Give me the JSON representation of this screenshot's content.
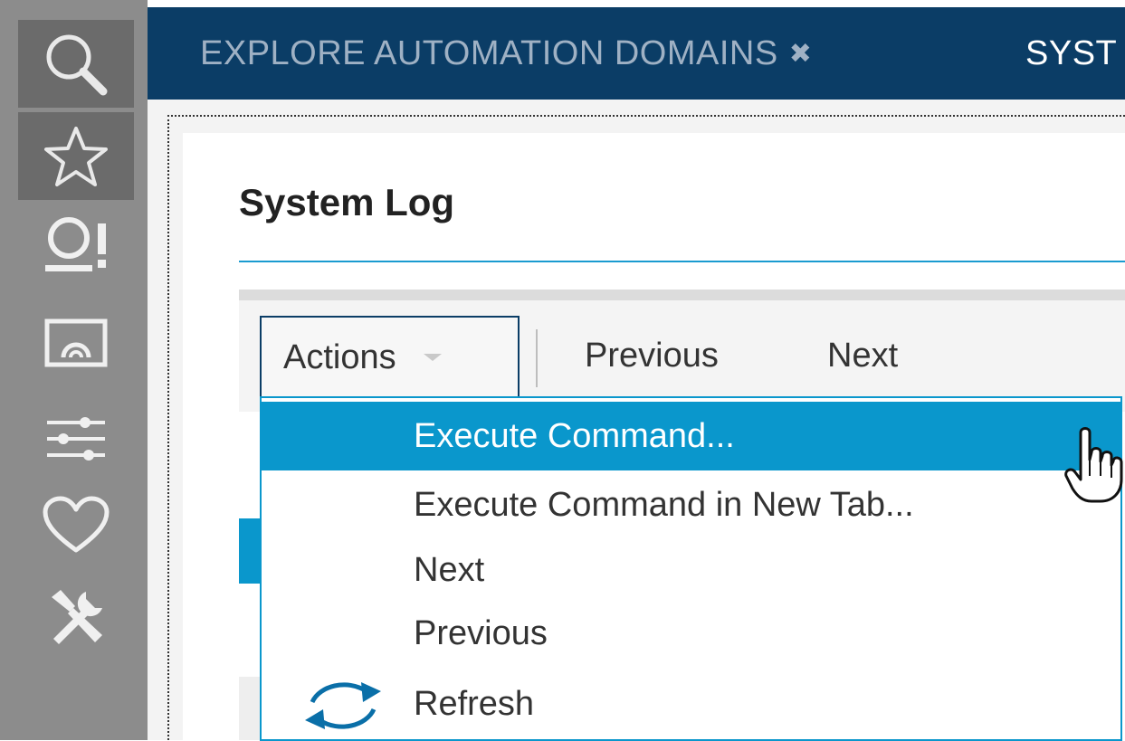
{
  "sidebar": {
    "items": [
      {
        "icon": "search-icon"
      },
      {
        "icon": "star-icon"
      },
      {
        "icon": "user-alert-icon"
      },
      {
        "icon": "monitor-icon"
      },
      {
        "icon": "sliders-icon"
      },
      {
        "icon": "heart-icon"
      },
      {
        "icon": "tools-icon"
      }
    ]
  },
  "tabs": [
    {
      "label": "EXPLORE AUTOMATION DOMAINS",
      "close": "✖"
    },
    {
      "label": "SYST"
    }
  ],
  "page": {
    "title": "System Log"
  },
  "toolbar": {
    "actions_label": "Actions",
    "previous_label": "Previous",
    "next_label": "Next"
  },
  "actions_menu": {
    "items": [
      {
        "label": "Execute Command...",
        "highlighted": true
      },
      {
        "label": "Execute Command in New Tab..."
      },
      {
        "label": "Next"
      },
      {
        "label": "Previous"
      },
      {
        "label": "Refresh",
        "icon": "refresh-icon"
      }
    ]
  },
  "colors": {
    "tabbar": "#0b3d66",
    "accent": "#0a97cc",
    "sidebar": "#8c8c8c"
  }
}
